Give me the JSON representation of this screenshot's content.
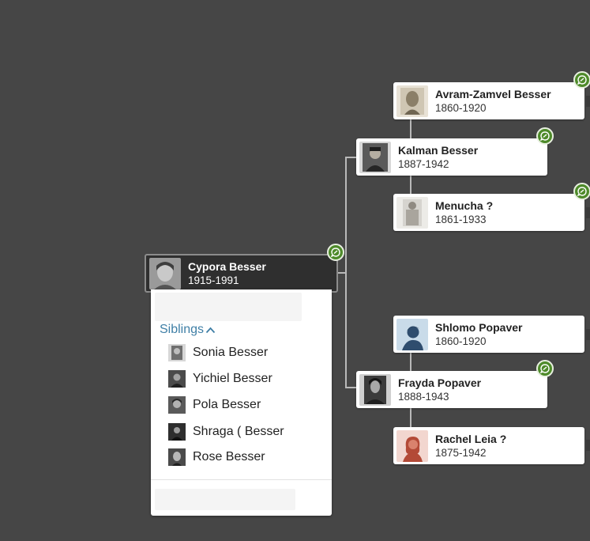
{
  "focus_person": {
    "name": "Cypora Besser",
    "dates": "1915-1991"
  },
  "parents": [
    {
      "name": "Kalman Besser",
      "dates": "1887-1942"
    },
    {
      "name": "Frayda Popaver",
      "dates": "1888-1943"
    }
  ],
  "grandparents": [
    {
      "name": "Avram-Zamvel Besser",
      "dates": "1860-1920"
    },
    {
      "name": "Menucha ?",
      "dates": "1861-1933"
    },
    {
      "name": "Shlomo Popaver",
      "dates": "1860-1920"
    },
    {
      "name": "Rachel Leia ?",
      "dates": "1875-1942"
    }
  ],
  "siblings_panel": {
    "toggle_label": "Siblings",
    "siblings": [
      "Sonia Besser",
      "Yichiel Besser",
      "Pola Besser",
      "Shraga ( Besser",
      "Rose Besser"
    ]
  },
  "colors": {
    "background": "#464646",
    "hint_green": "#4e8a2a",
    "link_blue": "#3f7fa6",
    "focus_card": "#2f2f2f"
  },
  "icons": [
    "record-hint-icon",
    "chevron-up-icon",
    "person-photo",
    "avatar-male-illustration",
    "avatar-female-illustration"
  ]
}
